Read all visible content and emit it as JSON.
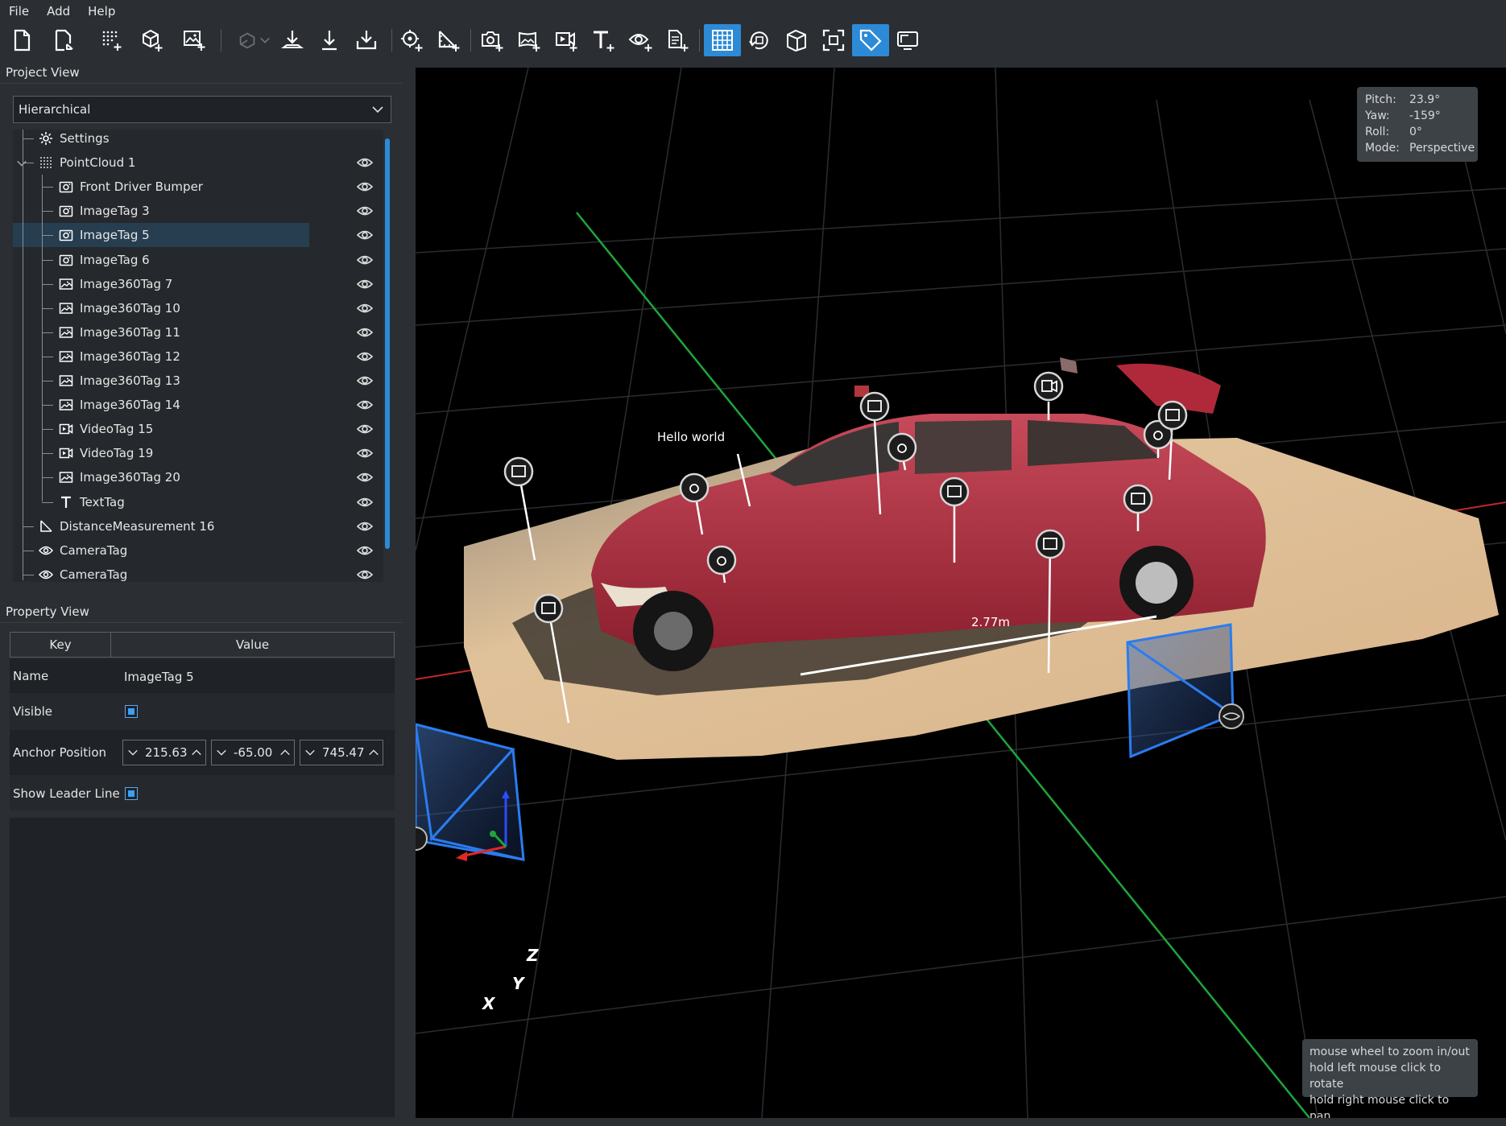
{
  "menu": [
    "File",
    "Add",
    "Help"
  ],
  "project_view": {
    "title": "Project View",
    "mode": "Hierarchical",
    "items": [
      {
        "label": "Settings",
        "icon": "gear-icon",
        "eye": false
      },
      {
        "label": "PointCloud 1",
        "icon": "pointcloud-icon",
        "eye": true
      },
      {
        "label": "Front Driver Bumper",
        "icon": "camera-icon",
        "eye": true
      },
      {
        "label": "ImageTag 3",
        "icon": "camera-icon",
        "eye": true
      },
      {
        "label": "ImageTag 5",
        "icon": "camera-icon",
        "eye": true,
        "selected": true
      },
      {
        "label": "ImageTag 6",
        "icon": "camera-icon",
        "eye": true
      },
      {
        "label": "Image360Tag 7",
        "icon": "image360-icon",
        "eye": true
      },
      {
        "label": "Image360Tag 10",
        "icon": "image360-icon",
        "eye": true
      },
      {
        "label": "Image360Tag 11",
        "icon": "image360-icon",
        "eye": true
      },
      {
        "label": "Image360Tag 12",
        "icon": "image360-icon",
        "eye": true
      },
      {
        "label": "Image360Tag 13",
        "icon": "image360-icon",
        "eye": true
      },
      {
        "label": "Image360Tag 14",
        "icon": "image360-icon",
        "eye": true
      },
      {
        "label": "VideoTag 15",
        "icon": "video-icon",
        "eye": true
      },
      {
        "label": "VideoTag 19",
        "icon": "video-icon",
        "eye": true
      },
      {
        "label": "Image360Tag 20",
        "icon": "image360-icon",
        "eye": true
      },
      {
        "label": "TextTag",
        "icon": "text-icon",
        "eye": true
      },
      {
        "label": "DistanceMeasurement 16",
        "icon": "ruler-icon",
        "eye": true
      },
      {
        "label": "CameraTag",
        "icon": "eye-icon",
        "eye": true
      },
      {
        "label": "CameraTag",
        "icon": "eye-icon",
        "eye": true
      }
    ]
  },
  "property_view": {
    "title": "Property View",
    "col_key": "Key",
    "col_value": "Value",
    "name_key": "Name",
    "name_value": "ImageTag 5",
    "visible_key": "Visible",
    "anchor_key": "Anchor Position",
    "anchor_x": "215.63",
    "anchor_y": "-65.00",
    "anchor_z": "745.47",
    "leader_key": "Show Leader Line"
  },
  "viewport": {
    "orientation": {
      "pitch_label": "Pitch:",
      "pitch": "23.9°",
      "yaw_label": "Yaw:",
      "yaw": "-159°",
      "roll_label": "Roll:",
      "roll": "0°",
      "mode_label": "Mode:",
      "mode": "Perspective"
    },
    "text_tag": "Hello world",
    "distance": "2.77m",
    "axes": {
      "x": "X",
      "y": "Y",
      "z": "Z"
    },
    "hint_lines": [
      "mouse wheel to zoom in/out",
      "hold left mouse click to rotate",
      "hold right mouse click to pan"
    ]
  },
  "colors": {
    "accent": "#2d8ad6",
    "panel": "#2b2f33",
    "car_red": "#b02a3c",
    "ground_sand": "#d9b98f",
    "grid_green": "#1fa53a",
    "grid_red": "#c0282a",
    "camera_blue": "#2a7cf0"
  }
}
